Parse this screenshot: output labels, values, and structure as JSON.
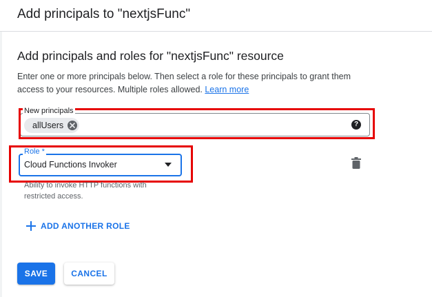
{
  "dialog": {
    "title": "Add principals to \"nextjsFunc\""
  },
  "section": {
    "title": "Add principals and roles for \"nextjsFunc\" resource",
    "description": "Enter one or more principals below. Then select a role for these principals to grant them access to your resources. Multiple roles allowed.",
    "learn_more": "Learn more"
  },
  "principals": {
    "label": "New principals",
    "chips": [
      "allUsers"
    ],
    "help_icon": "?"
  },
  "role": {
    "label": "Role *",
    "value": "Cloud Functions Invoker",
    "hint": "Ability to invoke HTTP functions with restricted access."
  },
  "add_role": {
    "label": "ADD ANOTHER ROLE"
  },
  "buttons": {
    "save": "SAVE",
    "cancel": "CANCEL"
  },
  "icons": {
    "chip_close": "close-circle-icon",
    "help": "help-circle-icon",
    "dropdown": "dropdown-arrow-icon",
    "delete": "trash-icon",
    "add": "plus-icon"
  },
  "colors": {
    "accent": "#1a73e8",
    "highlight": "#e60000",
    "text": "#202124",
    "muted": "#5f6368"
  }
}
